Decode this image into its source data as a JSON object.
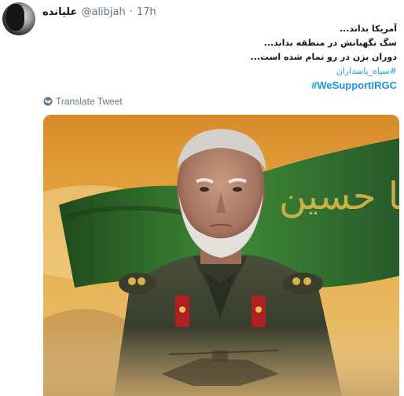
{
  "tweet": {
    "author_name": "علیانده",
    "handle": "@alibjah",
    "separator": "·",
    "time": "17h",
    "lines": [
      "آمریکا بداند...",
      "سگ نگهبانش در منطقه بداند...",
      "دوران بزن در رو تمام شده است..."
    ],
    "hashtag_fa": "#سپاه_پاسداران",
    "hashtag_en": "#WeSupportIRGC"
  },
  "translate_label": "Translate Tweet",
  "image": {
    "flag_text": "یا حسین"
  },
  "colors": {
    "link": "#1da1f2",
    "meta": "#657786",
    "flag_green": "#2f6b2a",
    "sky_orange": "#e8a23a"
  }
}
